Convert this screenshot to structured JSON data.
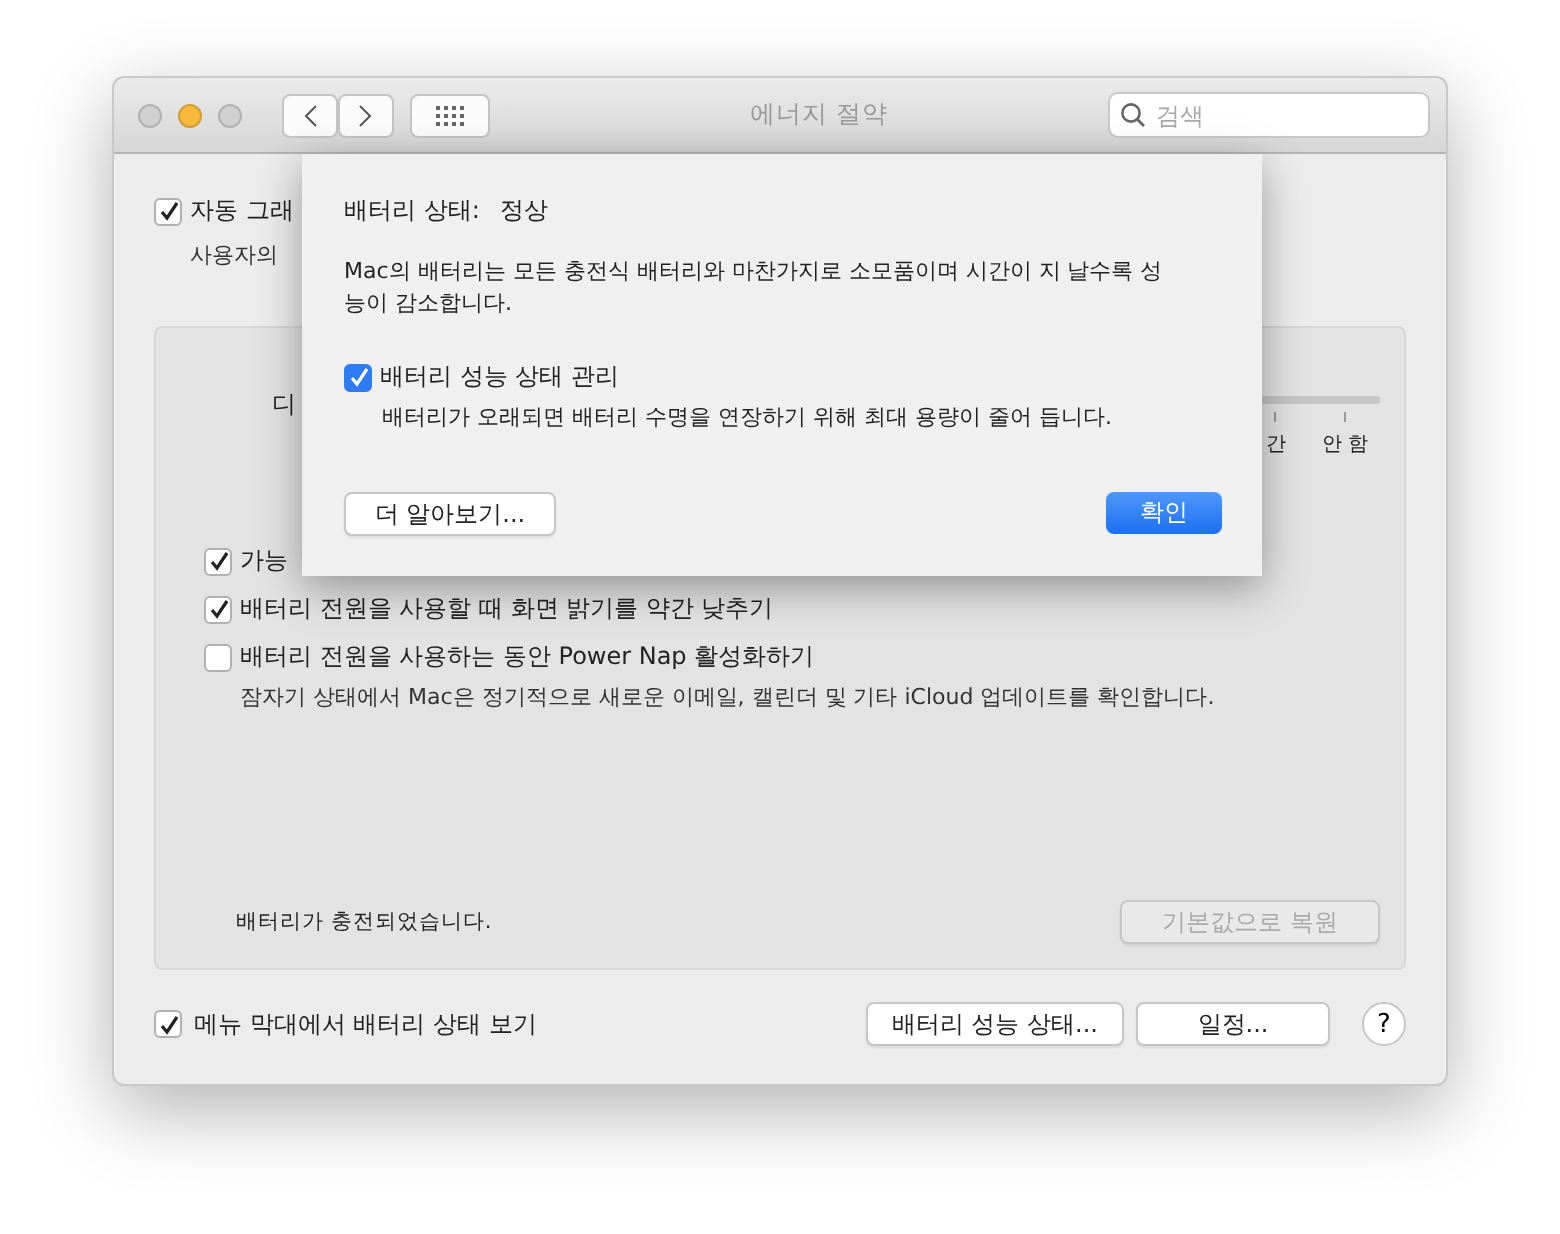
{
  "window": {
    "title": "에너지 절약",
    "search": {
      "placeholder": "검색"
    }
  },
  "background": {
    "graphics_option": {
      "label": "자동 그래",
      "checked": true
    },
    "graphics_note": "사용자의",
    "display_label": "디",
    "slider_labels": [
      "간",
      "안 함"
    ],
    "options": [
      {
        "label": "가능",
        "checked": true
      },
      {
        "label": "배터리 전원을 사용할 때 화면 밝기를 약간 낮추기",
        "checked": true
      },
      {
        "label": "배터리 전원을 사용하는 동안 Power Nap 활성화하기",
        "checked": false,
        "note": "잠자기 상태에서 Mac은 정기적으로 새로운 이메일, 캘린더 및 기타 iCloud 업데이트를 확인합니다."
      }
    ],
    "status": "배터리가 충전되었습니다.",
    "restore_button": {
      "label": "기본값으로 복원",
      "disabled": true
    }
  },
  "footer": {
    "menu_bar_option": {
      "label": "메뉴 막대에서 배터리 상태 보기",
      "checked": true
    },
    "buttons": [
      "배터리 성능 상태...",
      "일정..."
    ],
    "help": "?"
  },
  "sheet": {
    "status_label": "배터리 상태:",
    "status_value": "정상",
    "description": "Mac의 배터리는 모든 충전식 배터리와 마찬가지로 소모품이며 시간이 지 날수록 성능이 감소합니다.",
    "option": {
      "label": "배터리 성능 상태 관리",
      "checked": true,
      "note": "배터리가 오래되면 배터리 수명을 연장하기 위해 최대 용량이 줄어 듭니다."
    },
    "learn_more": "더 알아보기...",
    "ok": "확인"
  }
}
